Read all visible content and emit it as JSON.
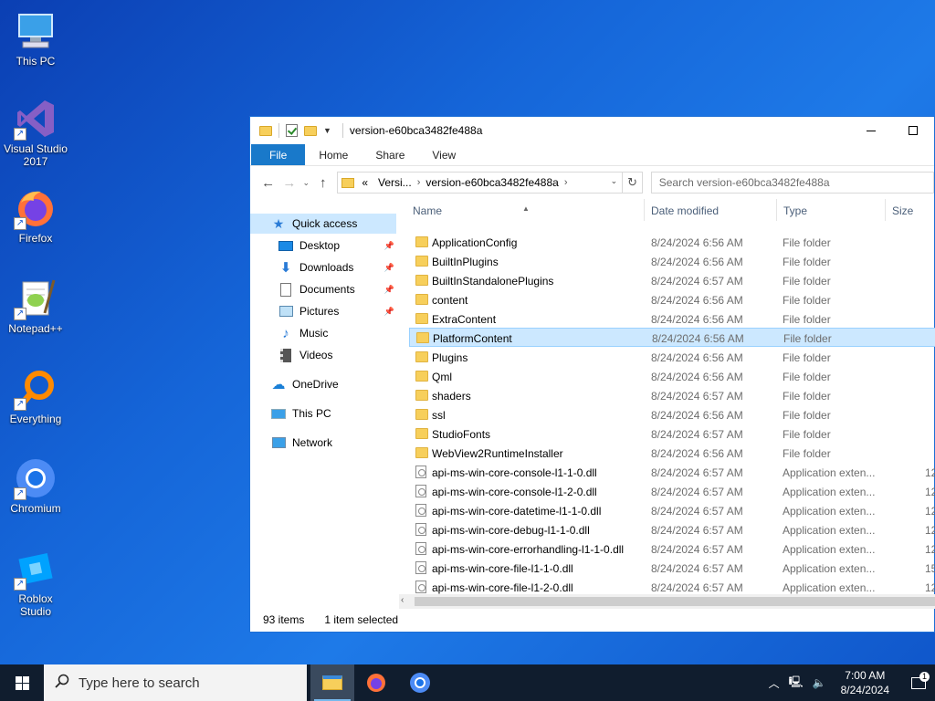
{
  "desktop": {
    "icons": [
      {
        "label": "This PC",
        "icon": "monitor-icon"
      },
      {
        "label": "Visual Studio 2017",
        "icon": "visual-studio-icon"
      },
      {
        "label": "Firefox",
        "icon": "firefox-icon"
      },
      {
        "label": "Notepad++",
        "icon": "notepadpp-icon"
      },
      {
        "label": "Everything",
        "icon": "everything-search-icon"
      },
      {
        "label": "Chromium",
        "icon": "chromium-icon"
      },
      {
        "label": "Roblox Studio",
        "icon": "roblox-studio-icon"
      }
    ]
  },
  "window": {
    "title": "version-e60bca3482fe488a",
    "ribbon_tabs": [
      "File",
      "Home",
      "Share",
      "View"
    ],
    "address": {
      "prefix": "«",
      "crumbs": [
        "Versi...",
        "version-e60bca3482fe488a"
      ]
    },
    "search_placeholder": "Search version-e60bca3482fe488a",
    "nav": {
      "quick_access": "Quick access",
      "pinned": [
        "Desktop",
        "Downloads",
        "Documents",
        "Pictures"
      ],
      "unpinned": [
        "Music",
        "Videos"
      ],
      "onedrive": "OneDrive",
      "this_pc": "This PC",
      "network": "Network"
    },
    "columns": {
      "name": "Name",
      "date": "Date modified",
      "type": "Type",
      "size": "Size"
    },
    "files": [
      {
        "name": "ApplicationConfig",
        "date": "8/24/2024 6:56 AM",
        "type": "File folder",
        "size": "",
        "kind": "folder"
      },
      {
        "name": "BuiltInPlugins",
        "date": "8/24/2024 6:56 AM",
        "type": "File folder",
        "size": "",
        "kind": "folder"
      },
      {
        "name": "BuiltInStandalonePlugins",
        "date": "8/24/2024 6:57 AM",
        "type": "File folder",
        "size": "",
        "kind": "folder"
      },
      {
        "name": "content",
        "date": "8/24/2024 6:56 AM",
        "type": "File folder",
        "size": "",
        "kind": "folder"
      },
      {
        "name": "ExtraContent",
        "date": "8/24/2024 6:56 AM",
        "type": "File folder",
        "size": "",
        "kind": "folder"
      },
      {
        "name": "PlatformContent",
        "date": "8/24/2024 6:56 AM",
        "type": "File folder",
        "size": "",
        "kind": "folder",
        "selected": true
      },
      {
        "name": "Plugins",
        "date": "8/24/2024 6:56 AM",
        "type": "File folder",
        "size": "",
        "kind": "folder"
      },
      {
        "name": "Qml",
        "date": "8/24/2024 6:56 AM",
        "type": "File folder",
        "size": "",
        "kind": "folder"
      },
      {
        "name": "shaders",
        "date": "8/24/2024 6:57 AM",
        "type": "File folder",
        "size": "",
        "kind": "folder"
      },
      {
        "name": "ssl",
        "date": "8/24/2024 6:56 AM",
        "type": "File folder",
        "size": "",
        "kind": "folder"
      },
      {
        "name": "StudioFonts",
        "date": "8/24/2024 6:57 AM",
        "type": "File folder",
        "size": "",
        "kind": "folder"
      },
      {
        "name": "WebView2RuntimeInstaller",
        "date": "8/24/2024 6:56 AM",
        "type": "File folder",
        "size": "",
        "kind": "folder"
      },
      {
        "name": "api-ms-win-core-console-l1-1-0.dll",
        "date": "8/24/2024 6:57 AM",
        "type": "Application exten...",
        "size": "12",
        "kind": "dll"
      },
      {
        "name": "api-ms-win-core-console-l1-2-0.dll",
        "date": "8/24/2024 6:57 AM",
        "type": "Application exten...",
        "size": "12",
        "kind": "dll"
      },
      {
        "name": "api-ms-win-core-datetime-l1-1-0.dll",
        "date": "8/24/2024 6:57 AM",
        "type": "Application exten...",
        "size": "12",
        "kind": "dll"
      },
      {
        "name": "api-ms-win-core-debug-l1-1-0.dll",
        "date": "8/24/2024 6:57 AM",
        "type": "Application exten...",
        "size": "12",
        "kind": "dll"
      },
      {
        "name": "api-ms-win-core-errorhandling-l1-1-0.dll",
        "date": "8/24/2024 6:57 AM",
        "type": "Application exten...",
        "size": "12",
        "kind": "dll"
      },
      {
        "name": "api-ms-win-core-file-l1-1-0.dll",
        "date": "8/24/2024 6:57 AM",
        "type": "Application exten...",
        "size": "15",
        "kind": "dll"
      },
      {
        "name": "api-ms-win-core-file-l1-2-0.dll",
        "date": "8/24/2024 6:57 AM",
        "type": "Application exten...",
        "size": "12",
        "kind": "dll"
      }
    ],
    "status": {
      "count": "93 items",
      "selection": "1 item selected"
    }
  },
  "taskbar": {
    "search_placeholder": "Type here to search",
    "apps": [
      {
        "name": "File Explorer",
        "icon": "file-explorer-icon",
        "active": true
      },
      {
        "name": "Firefox",
        "icon": "firefox-icon",
        "active": false
      },
      {
        "name": "Chromium",
        "icon": "chromium-icon",
        "active": false
      }
    ],
    "clock": {
      "time": "7:00 AM",
      "date": "8/24/2024"
    },
    "notification_count": "1"
  },
  "colors": {
    "accent": "#1979ca",
    "selection": "#cce8ff",
    "folder": "#f7cf5b",
    "taskbar": "#101d2e"
  }
}
